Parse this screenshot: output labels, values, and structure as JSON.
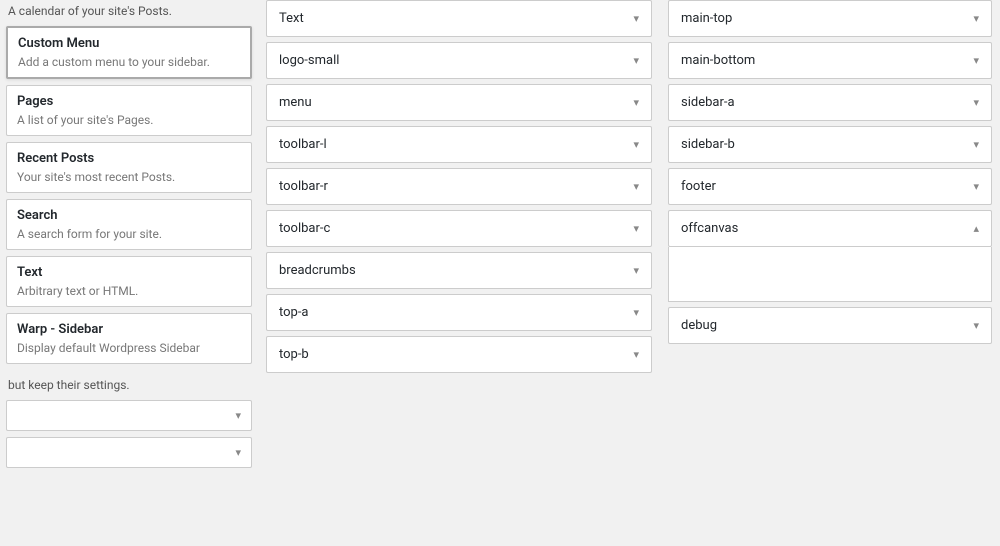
{
  "left": {
    "top_note": "A calendar of your site's Posts.",
    "widgets": [
      {
        "id": "custom-menu",
        "title": "Custom Menu",
        "desc": "Add a custom menu to your sidebar.",
        "active": true
      },
      {
        "id": "pages",
        "title": "Pages",
        "desc": "A list of your site's Pages."
      },
      {
        "id": "recent-posts",
        "title": "Recent Posts",
        "desc": "Your site's most recent Posts."
      },
      {
        "id": "search",
        "title": "Search",
        "desc": "A search form for your site."
      },
      {
        "id": "text",
        "title": "Text",
        "desc": "Arbitrary text or HTML."
      },
      {
        "id": "warp-sidebar",
        "title": "Warp - Sidebar",
        "desc": "Display default Wordpress Sidebar"
      }
    ],
    "bottom_note": "but keep their settings.",
    "collapsed_widgets": [
      {
        "id": "collapsed-1",
        "label": ""
      },
      {
        "id": "collapsed-2",
        "label": ""
      }
    ]
  },
  "middle": {
    "areas": [
      {
        "id": "text-top",
        "label": "Text"
      },
      {
        "id": "logo-small",
        "label": "logo-small"
      },
      {
        "id": "menu",
        "label": "menu"
      },
      {
        "id": "toolbar-l",
        "label": "toolbar-l"
      },
      {
        "id": "toolbar-r",
        "label": "toolbar-r"
      },
      {
        "id": "toolbar-c",
        "label": "toolbar-c"
      },
      {
        "id": "breadcrumbs",
        "label": "breadcrumbs"
      },
      {
        "id": "top-a",
        "label": "top-a"
      },
      {
        "id": "top-b",
        "label": "top-b"
      }
    ]
  },
  "right": {
    "top_area": {
      "id": "main-top",
      "label": "main-top"
    },
    "areas": [
      {
        "id": "main-bottom",
        "label": "main-bottom"
      },
      {
        "id": "sidebar-a",
        "label": "sidebar-a"
      },
      {
        "id": "sidebar-b",
        "label": "sidebar-b"
      },
      {
        "id": "footer",
        "label": "footer"
      },
      {
        "id": "offcanvas",
        "label": "offcanvas",
        "expanded": true
      },
      {
        "id": "debug",
        "label": "debug"
      }
    ]
  },
  "icons": {
    "chevron_down": "▾",
    "chevron_up": "▴"
  }
}
